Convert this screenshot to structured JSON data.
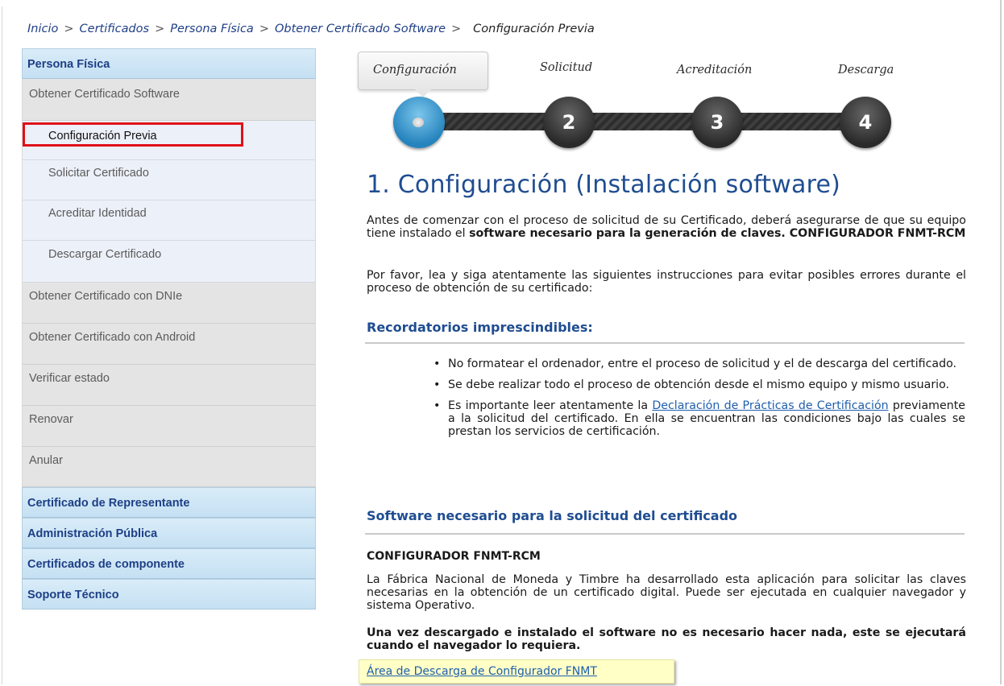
{
  "breadcrumb": {
    "items": [
      "Inicio",
      "Certificados",
      "Persona Física",
      "Obtener Certificado Software"
    ],
    "separator": ">",
    "current": "Configuración Previa"
  },
  "sidebar": {
    "section_persona": "Persona Física",
    "item_software": "Obtener Certificado Software",
    "sub_items": [
      "Configuración Previa",
      "Solicitar Certificado",
      "Acreditar Identidad",
      "Descargar Certificado"
    ],
    "items_after": [
      "Obtener Certificado con DNIe",
      "Obtener Certificado con Android",
      "Verificar estado",
      "Renovar",
      "Anular"
    ],
    "sections_after": [
      "Certificado de Representante",
      "Administración Pública",
      "Certificados de componente",
      "Soporte Técnico"
    ]
  },
  "steps": {
    "labels": [
      "Configuración",
      "Solicitud",
      "Acreditación",
      "Descarga"
    ],
    "numbers": [
      "2",
      "3",
      "4"
    ],
    "active_index": 0
  },
  "main": {
    "title": "1. Configuración (Instalación software)",
    "intro_1": "Antes de comenzar con el proceso de solicitud de su Certificado, deberá asegurarse de que su equipo tiene instalado el ",
    "intro_1_bold": "software necesario para la generación de claves. CONFIGURADOR FNMT-RCM",
    "intro_2": "Por favor, lea y siga atentamente las siguientes instrucciones para evitar posibles errores durante el proceso de obtención de su certificado:",
    "reminders_heading": "Recordatorios imprescindibles:",
    "bullets": {
      "b1": "No formatear el ordenador, entre el proceso de solicitud y el de descarga del certificado.",
      "b2": "Se debe realizar todo el proceso de obtención desde el mismo equipo y mismo usuario.",
      "b3_before": "Es importante leer atentamente la ",
      "b3_link": "Declaración de Prácticas de Certificación",
      "b3_after": " previamente a la solicitud del certificado. En ella se encuentran las condiciones bajo las cuales se prestan los servicios de certificación."
    },
    "software_heading": "Software necesario para la solicitud del certificado",
    "configurador_title": "CONFIGURADOR FNMT-RCM",
    "configurador_desc": "La Fábrica Nacional de Moneda y Timbre ha desarrollado esta aplicación para solicitar las claves necesarias en la obtención de un certificado digital. Puede ser ejecutada en cualquier navegador y sistema Operativo.",
    "note_bold": "Una vez descargado e instalado el software no es necesario hacer nada, este se ejecutará cuando el navegador lo requiera.",
    "download_link": "Área de Descarga de Configurador FNMT"
  },
  "colors": {
    "brand_blue": "#1f4d91",
    "link_blue": "#1f5fae",
    "active_step": "#2583bd",
    "highlight_red": "#e0101a",
    "note_yellow": "#ffffc6"
  }
}
